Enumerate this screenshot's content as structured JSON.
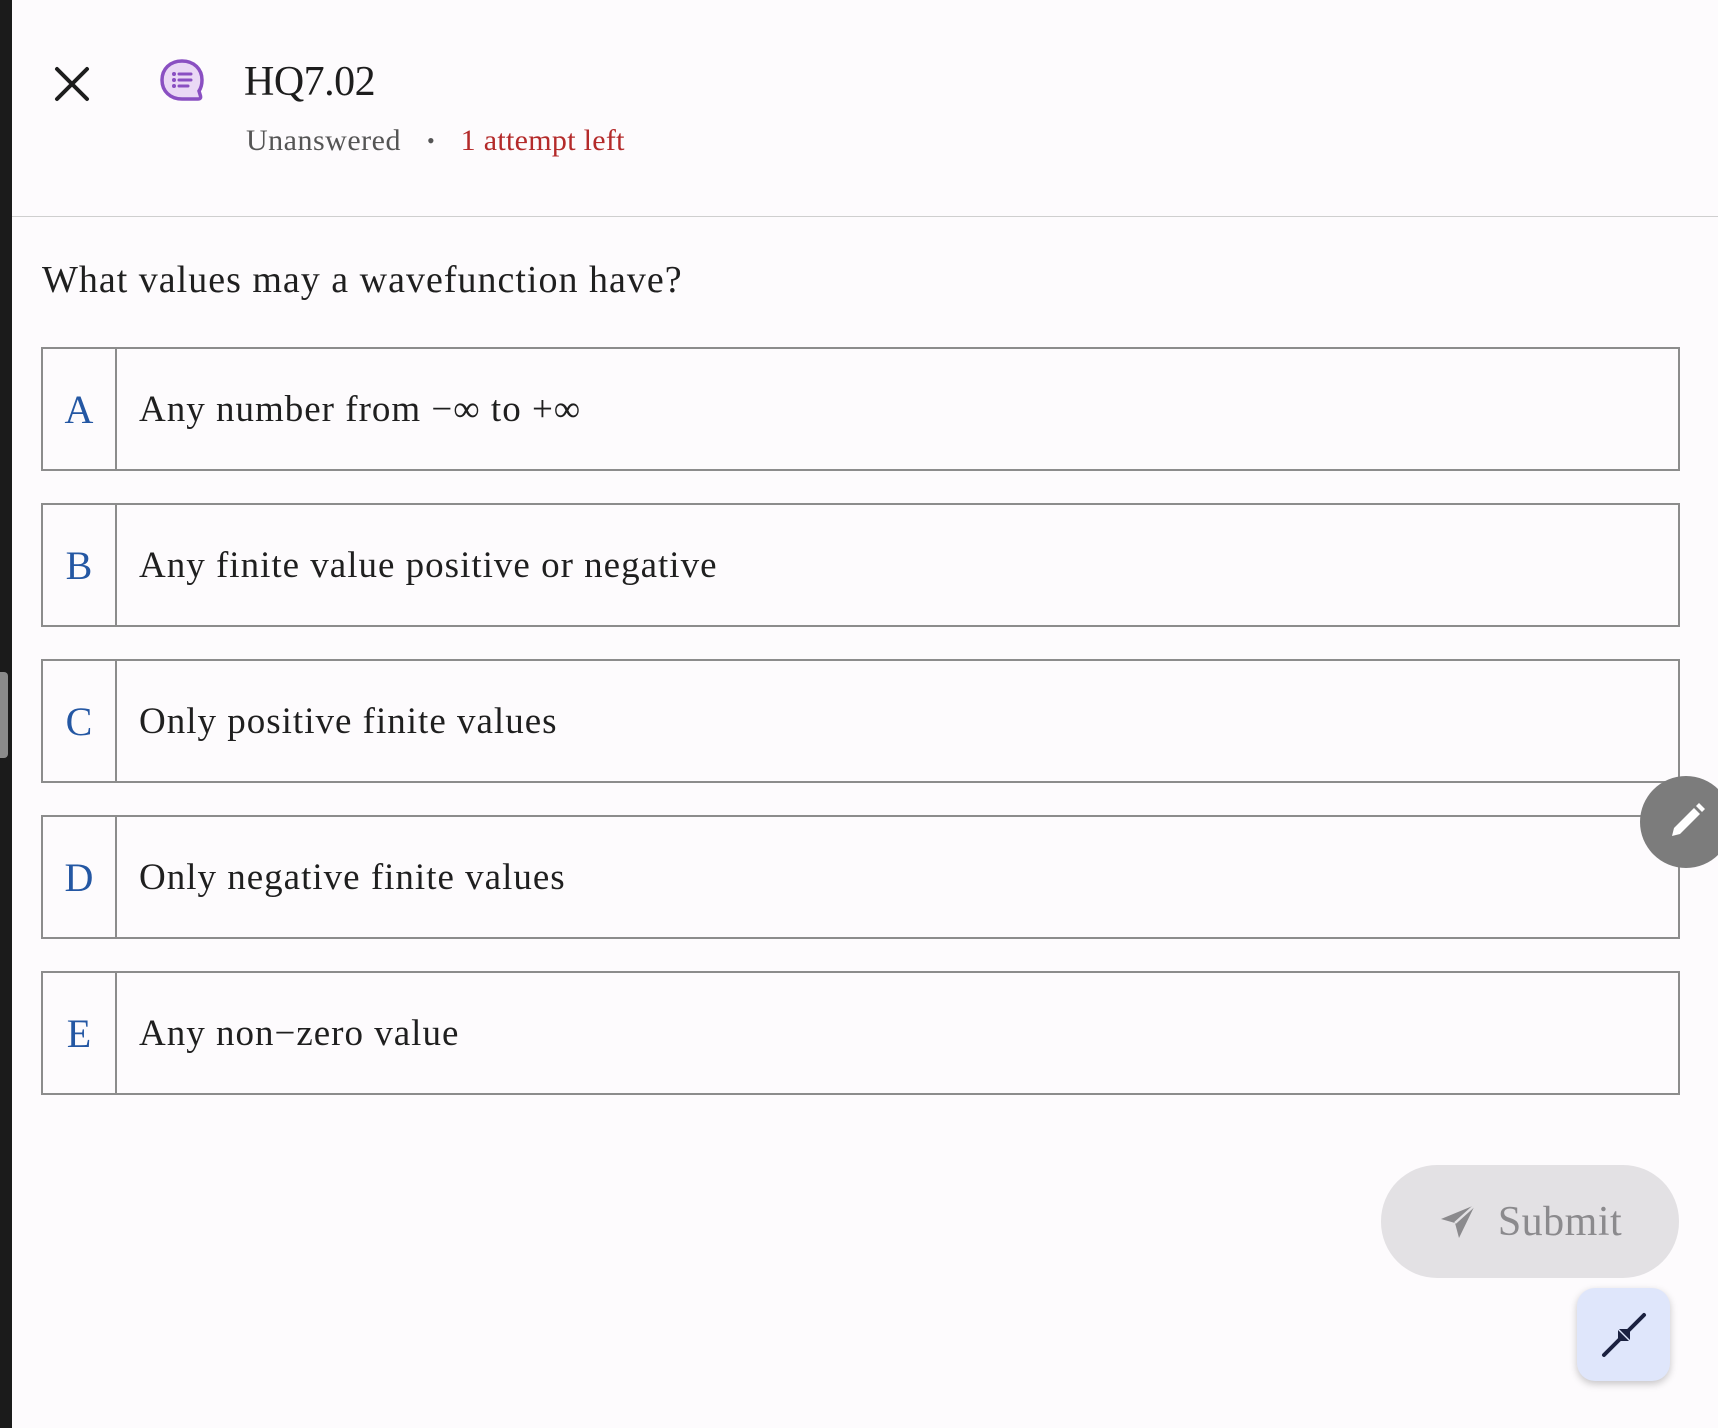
{
  "header": {
    "title": "HQ7.02",
    "status": "Unanswered",
    "separator": "•",
    "attempts": "1 attempt left",
    "icons": {
      "close": "close-icon",
      "question": "question-chat-icon"
    }
  },
  "question": {
    "text": "What values may a wavefunction have?",
    "options": [
      {
        "letter": "A",
        "text": "Any number from −∞ to +∞"
      },
      {
        "letter": "B",
        "text": "Any finite value positive or negative"
      },
      {
        "letter": "C",
        "text": "Only positive finite values"
      },
      {
        "letter": "D",
        "text": "Only negative finite values"
      },
      {
        "letter": "E",
        "text": "Any non−zero value"
      }
    ]
  },
  "actions": {
    "submit_label": "Submit",
    "submit_icon": "send-icon",
    "edit_icon": "pencil-icon",
    "collapse_icon": "collapse-icon"
  },
  "colors": {
    "attempts": "#b42a2a",
    "option_letter": "#2457a3",
    "question_icon": "#8a4fc2",
    "submit_bg": "#e3e1e4",
    "collapse_bg": "#dfe6fb"
  }
}
